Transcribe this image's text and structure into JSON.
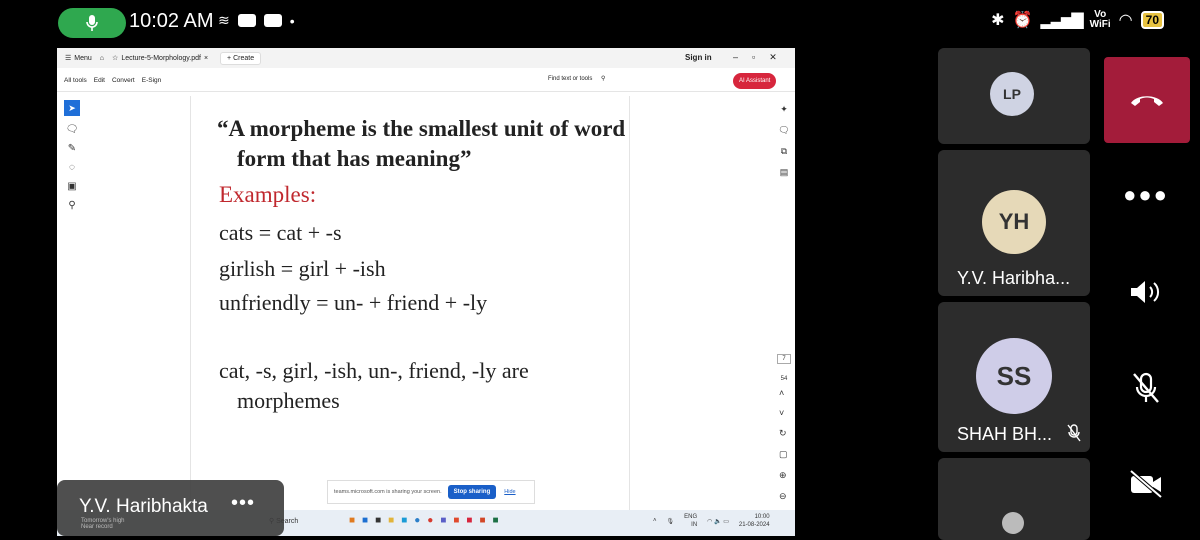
{
  "status_bar": {
    "time": "10:02 AM",
    "network_label_top": "Vo",
    "network_label_bottom": "WiFi",
    "battery": "70"
  },
  "pdf_app": {
    "menu": "Menu",
    "tab_title": "Lecture-5-Morphology.pdf",
    "new_tab": "+ Create",
    "sign_in": "Sign in",
    "toolbar": [
      "All tools",
      "Edit",
      "Convert",
      "E-Sign"
    ],
    "find": "Find text or tools",
    "ai_assistant": "AI Assistant",
    "page_number": "7",
    "page_total": "54"
  },
  "slide": {
    "quote_line1": "“A morpheme is the smallest unit of word",
    "quote_line2": "form that has meaning”",
    "examples_label": "Examples:",
    "example_lines": [
      "cats = cat + -s",
      "girlish = girl + -ish",
      "unfriendly = un- + friend + -ly"
    ],
    "morphemes_line1": "cat, -s, girl, -ish, un-, friend, -ly are",
    "morphemes_line2": "morphemes"
  },
  "share_bar": {
    "message": "teams.microsoft.com is sharing your screen.",
    "stop": "Stop sharing",
    "hide": "Hide"
  },
  "windows_taskbar": {
    "weather_line1": "Tomorrow's high",
    "weather_line2": "Near record",
    "search": "Search",
    "lang_top": "ENG",
    "lang_bottom": "IN",
    "clock_time": "10:00",
    "clock_date": "21-08-2024"
  },
  "presenter": {
    "name": "Y.V. Haribhakta",
    "more": "•••"
  },
  "participants": [
    {
      "initials": "LP",
      "name": ""
    },
    {
      "initials": "YH",
      "name": "Y.V. Haribha..."
    },
    {
      "initials": "SS",
      "name": "SHAH BH..."
    }
  ],
  "colors": {
    "end_call": "#a31c3a",
    "mic_pill": "#2fa84f",
    "avatar_lp": "#cfd3e3",
    "avatar_yh": "#e6d9b8",
    "avatar_ss": "#cfcde8",
    "examples_red": "#c0282e"
  }
}
